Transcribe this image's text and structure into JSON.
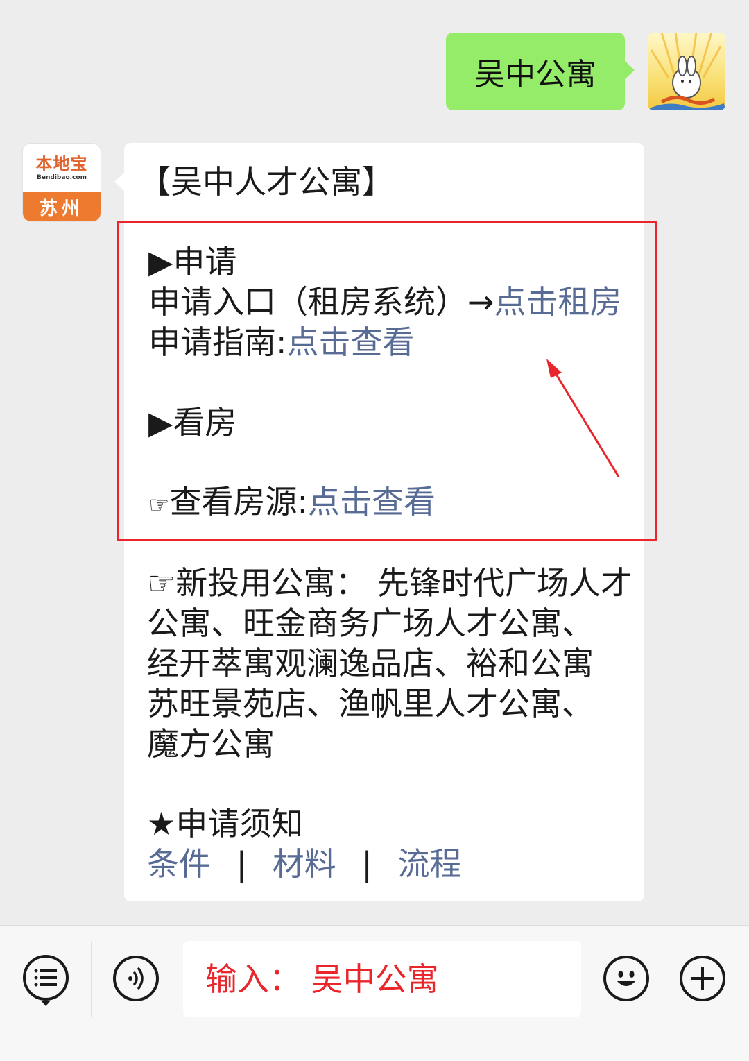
{
  "outgoing_message": {
    "text": "吴中公寓"
  },
  "account": {
    "logo_text": "本地宝",
    "site": "Bendibao.com",
    "city": "苏州"
  },
  "card": {
    "title": "【吴中人才公寓】",
    "apply": {
      "heading": "▶申请",
      "entry_label": "申请入口（租房系统）→",
      "entry_link": "点击租房",
      "guide_label": "申请指南:",
      "guide_link": "点击查看"
    },
    "viewing": {
      "heading": "▶看房",
      "listings_prefix": "☞",
      "listings_label": "查看房源:",
      "listings_link": "点击查看"
    },
    "new_apartments": {
      "lines": [
        "☞新投用公寓：  先锋时代广场人才",
        "公寓、旺金商务广场人才公寓、",
        "经开萃寓观澜逸品店、裕和公寓",
        "苏旺景苑店、渔帆里人才公寓、",
        "魔方公寓"
      ]
    },
    "notice": {
      "heading": "★申请须知",
      "links": [
        "条件",
        "材料",
        "流程"
      ],
      "separator": "|"
    }
  },
  "input_bar": {
    "value": "输入：  吴中公寓"
  },
  "colors": {
    "link": "#576b95",
    "highlight_red": "#e8262b",
    "outgoing_bubble": "#95ec69"
  }
}
